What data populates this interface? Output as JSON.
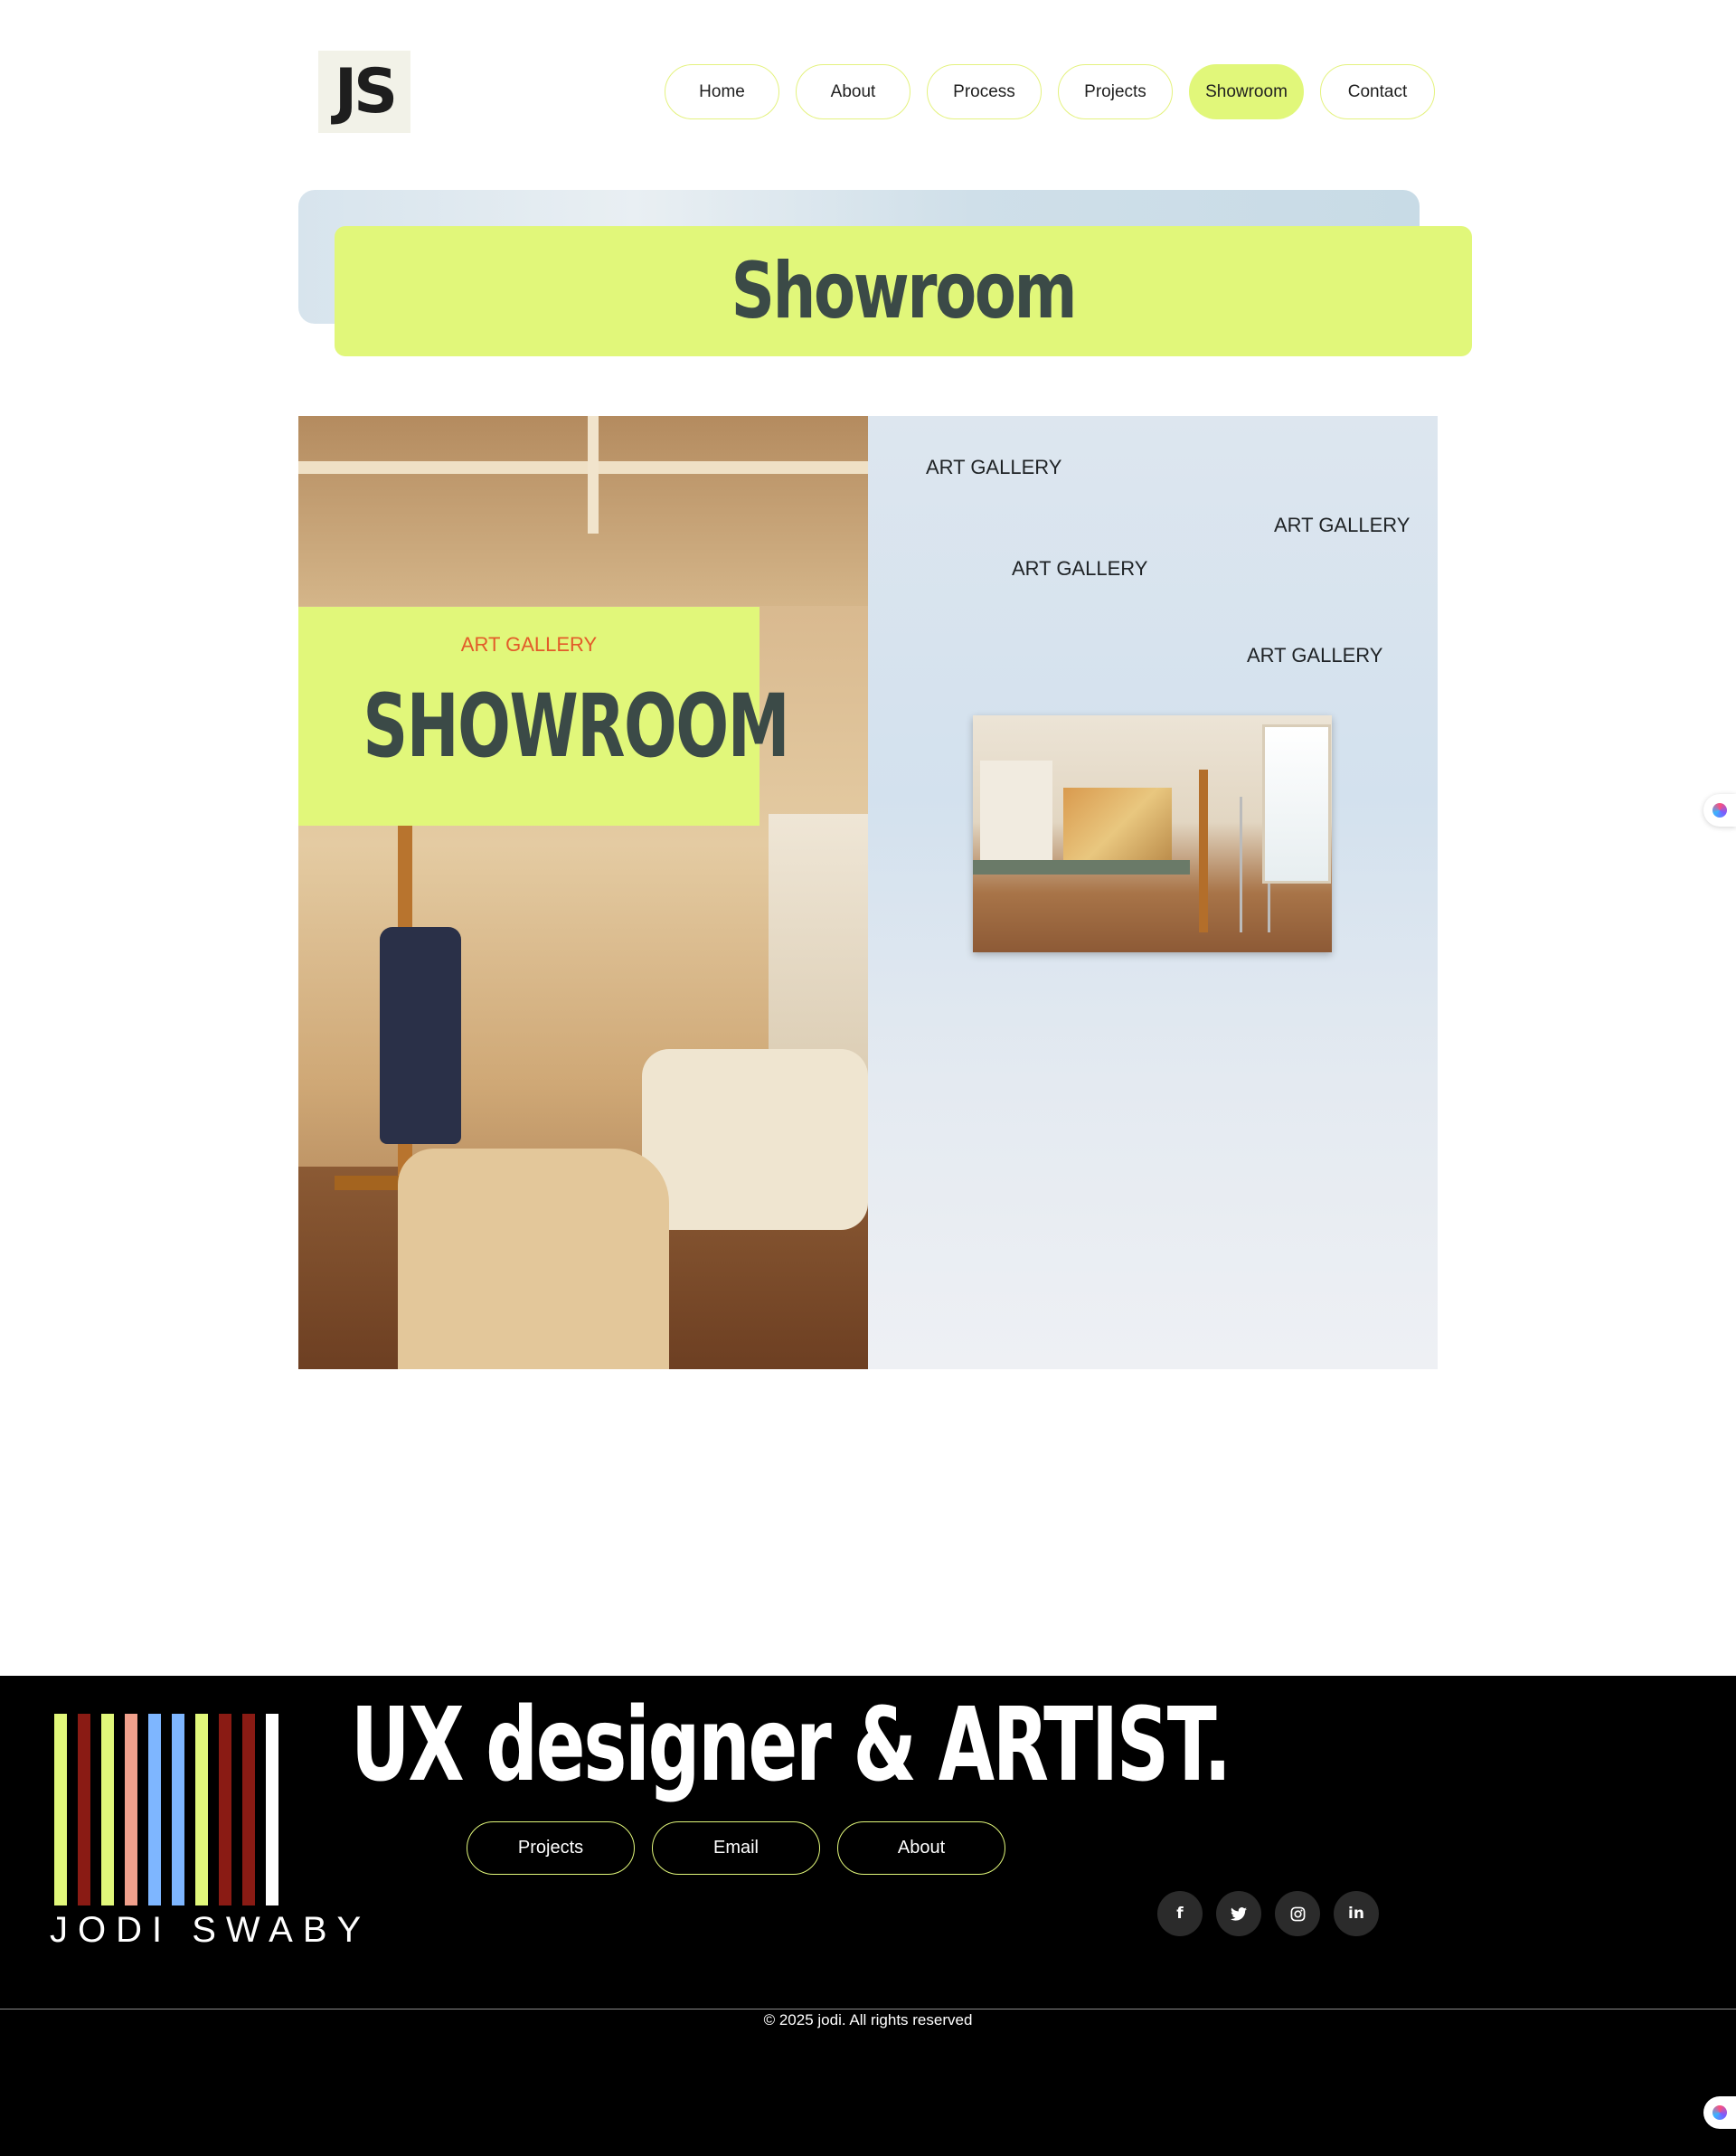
{
  "header": {
    "logo_text": "JS",
    "nav": [
      {
        "label": "Home",
        "active": false
      },
      {
        "label": "About",
        "active": false
      },
      {
        "label": "Process",
        "active": false
      },
      {
        "label": "Projects",
        "active": false
      },
      {
        "label": "Showroom",
        "active": true
      },
      {
        "label": "Contact",
        "active": false
      }
    ]
  },
  "page_title": "Showroom",
  "showroom": {
    "overlay_label": "ART GALLERY",
    "overlay_heading": "SHOWROOM",
    "gallery_labels": [
      "ART GALLERY",
      "ART GALLERY",
      "ART GALLERY",
      "ART GALLERY"
    ]
  },
  "footer": {
    "brand_name": "JODI SWABY",
    "tagline": "UX designer & ARTIST.",
    "links": [
      "Projects",
      "Email",
      "About"
    ],
    "social_icons": [
      "facebook-icon",
      "twitter-icon",
      "instagram-icon",
      "linkedin-icon"
    ],
    "copyright": "© 2025 jodi. All rights reserved",
    "barcode_colors": [
      "#e1f77a",
      "#8a1b14",
      "#e1f77a",
      "#f0a08c",
      "#7eb6ff",
      "#7eb6ff",
      "#e1f77a",
      "#8a1b14",
      "#8a1b14",
      "#ffffff"
    ]
  },
  "colors": {
    "accent": "#e1f77a",
    "heading": "#3b4a47",
    "label_orange": "#e25b2a",
    "footer_bg": "#000000"
  }
}
